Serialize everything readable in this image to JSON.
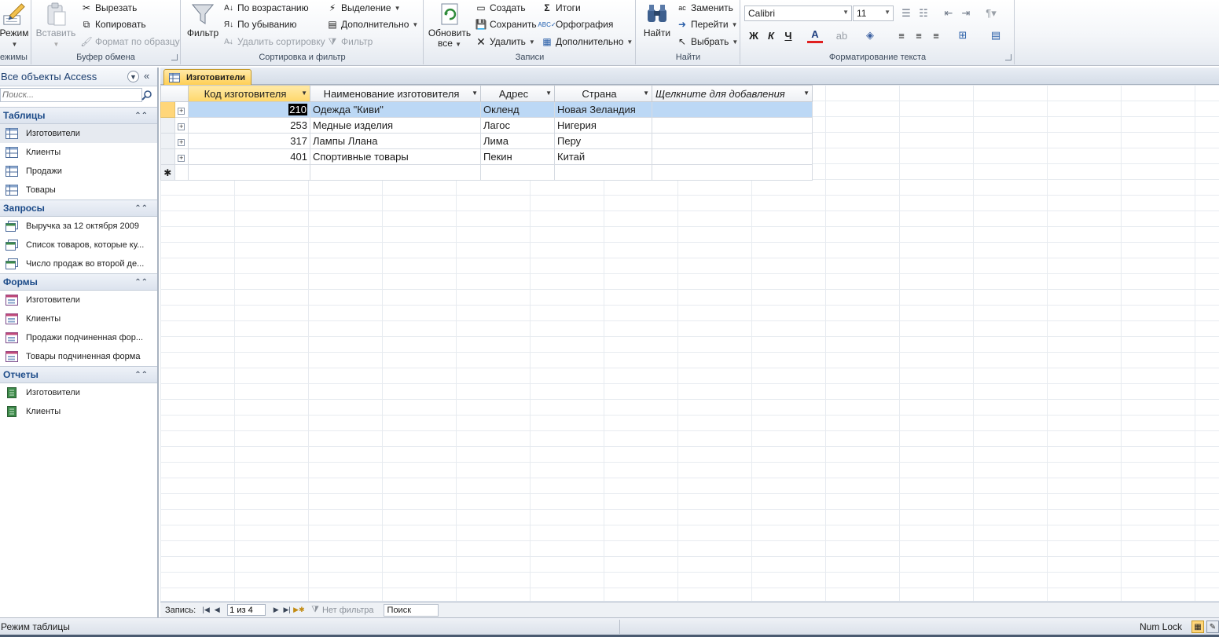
{
  "ribbon": {
    "views": {
      "label": "Режим",
      "group": "ежимы"
    },
    "clipboard": {
      "paste": "Вставить",
      "cut": "Вырезать",
      "copy": "Копировать",
      "format_painter": "Формат по образцу",
      "group": "Буфер обмена"
    },
    "sort_filter": {
      "filter": "Фильтр",
      "ascending": "По возрастанию",
      "descending": "По убыванию",
      "remove_sort": "Удалить сортировку",
      "selection": "Выделение",
      "advanced": "Дополнительно",
      "toggle_filter": "Фильтр",
      "group": "Сортировка и фильтр"
    },
    "records": {
      "refresh_line1": "Обновить",
      "refresh_line2": "все",
      "new": "Создать",
      "save": "Сохранить",
      "delete": "Удалить",
      "totals": "Итоги",
      "spelling": "Орфография",
      "more": "Дополнительно",
      "group": "Записи"
    },
    "find": {
      "find": "Найти",
      "replace": "Заменить",
      "goto": "Перейти",
      "select": "Выбрать",
      "group": "Найти"
    },
    "text_formatting": {
      "font": "Calibri",
      "size": "11",
      "bold": "Ж",
      "italic": "К",
      "underline": "Ч",
      "font_color": "A",
      "group": "Форматирование текста"
    }
  },
  "nav": {
    "title": "Все объекты Access",
    "search_placeholder": "Поиск...",
    "sections": [
      {
        "title": "Таблицы",
        "items": [
          "Изготовители",
          "Клиенты",
          "Продажи",
          "Товары"
        ]
      },
      {
        "title": "Запросы",
        "items": [
          "Выручка за 12 октября 2009",
          "Список товаров, которые ку...",
          "Число продаж во второй де..."
        ]
      },
      {
        "title": "Формы",
        "items": [
          "Изготовители",
          "Клиенты",
          "Продажи подчиненная фор...",
          "Товары подчиненная форма"
        ]
      },
      {
        "title": "Отчеты",
        "items": [
          "Изготовители",
          "Клиенты"
        ]
      }
    ]
  },
  "document": {
    "tab": "Изготовители",
    "columns": [
      "Код изготовителя",
      "Наименование изготовителя",
      "Адрес",
      "Страна",
      "Щелкните для добавления"
    ],
    "rows": [
      {
        "code": "210",
        "name": "Одежда \"Киви\"",
        "address": "Окленд",
        "country": "Новая Зеландия"
      },
      {
        "code": "253",
        "name": "Медные изделия",
        "address": "Лагос",
        "country": "Нигерия"
      },
      {
        "code": "317",
        "name": "Лампы Ллана",
        "address": "Лима",
        "country": "Перу"
      },
      {
        "code": "401",
        "name": "Спортивные товары",
        "address": "Пекин",
        "country": "Китай"
      }
    ],
    "new_row_marker": "✱"
  },
  "record_nav": {
    "label": "Запись:",
    "position": "1 из 4",
    "filter": "Нет фильтра",
    "search": "Поиск"
  },
  "status": {
    "mode": "Режим таблицы",
    "numlock": "Num Lock"
  },
  "colors": {
    "accent_tab": "#ffcf55",
    "current_row": "#bcd8f5",
    "section_text": "#1b4a88"
  }
}
